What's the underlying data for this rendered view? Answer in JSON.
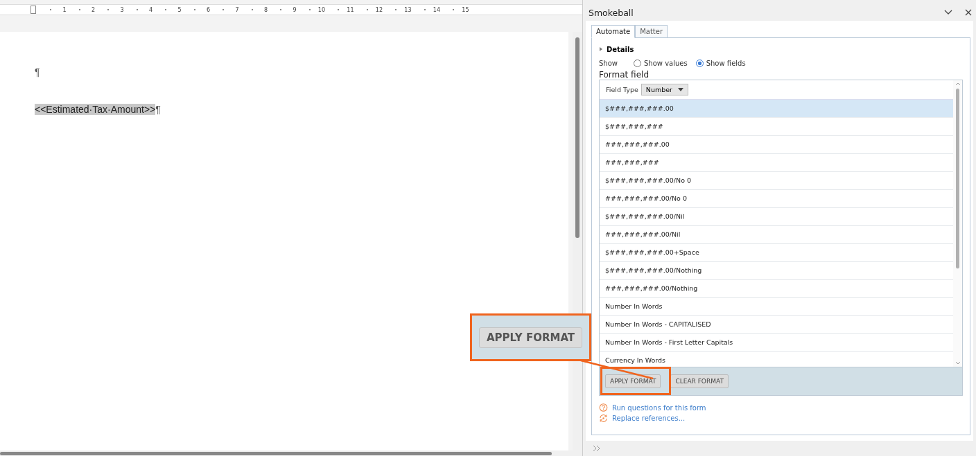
{
  "ruler": {
    "numbers": [
      "1",
      "2",
      "3",
      "4",
      "5",
      "6",
      "7",
      "8",
      "9",
      "10",
      "11",
      "12",
      "13",
      "14",
      "15"
    ]
  },
  "document": {
    "paragraphs": [
      {
        "text": "¶",
        "field": false
      },
      {
        "text": "<<Estimated·Tax·Amount>>",
        "field": true,
        "mark": "¶"
      }
    ]
  },
  "pane": {
    "title": "Smokeball",
    "tabs": [
      {
        "label": "Automate",
        "selected": true
      },
      {
        "label": "Matter",
        "selected": false
      }
    ],
    "details": {
      "label": "Details",
      "expanded": false
    },
    "show": {
      "label": "Show",
      "options": [
        {
          "label": "Show values",
          "selected": false
        },
        {
          "label": "Show fields",
          "selected": true
        }
      ]
    },
    "section_title": "Format field",
    "field_type": {
      "label": "Field Type",
      "value": "Number"
    },
    "formats": [
      {
        "label": "$###,###,###.00",
        "selected": true
      },
      {
        "label": "$###,###,###",
        "selected": false
      },
      {
        "label": "###,###,###.00",
        "selected": false
      },
      {
        "label": "###,###,###",
        "selected": false
      },
      {
        "label": "$###,###,###.00/No 0",
        "selected": false
      },
      {
        "label": "###,###,###.00/No 0",
        "selected": false
      },
      {
        "label": "$###,###,###.00/Nil",
        "selected": false
      },
      {
        "label": "###,###,###.00/Nil",
        "selected": false
      },
      {
        "label": "$###,###,###.00+Space",
        "selected": false
      },
      {
        "label": "$###,###,###.00/Nothing",
        "selected": false
      },
      {
        "label": "###,###,###.00/Nothing",
        "selected": false
      },
      {
        "label": "Number In Words",
        "selected": false
      },
      {
        "label": "Number In Words - CAPITALISED",
        "selected": false
      },
      {
        "label": "Number In Words - First Letter Capitals",
        "selected": false
      },
      {
        "label": "Currency In Words",
        "selected": false
      }
    ],
    "buttons": [
      {
        "label": "APPLY FORMAT"
      },
      {
        "label": "CLEAR FORMAT"
      }
    ],
    "links": [
      {
        "label": "Run questions for this form",
        "kind": "question"
      },
      {
        "label": "Replace references...",
        "kind": "replace"
      }
    ]
  },
  "callout": {
    "label": "APPLY FORMAT"
  }
}
